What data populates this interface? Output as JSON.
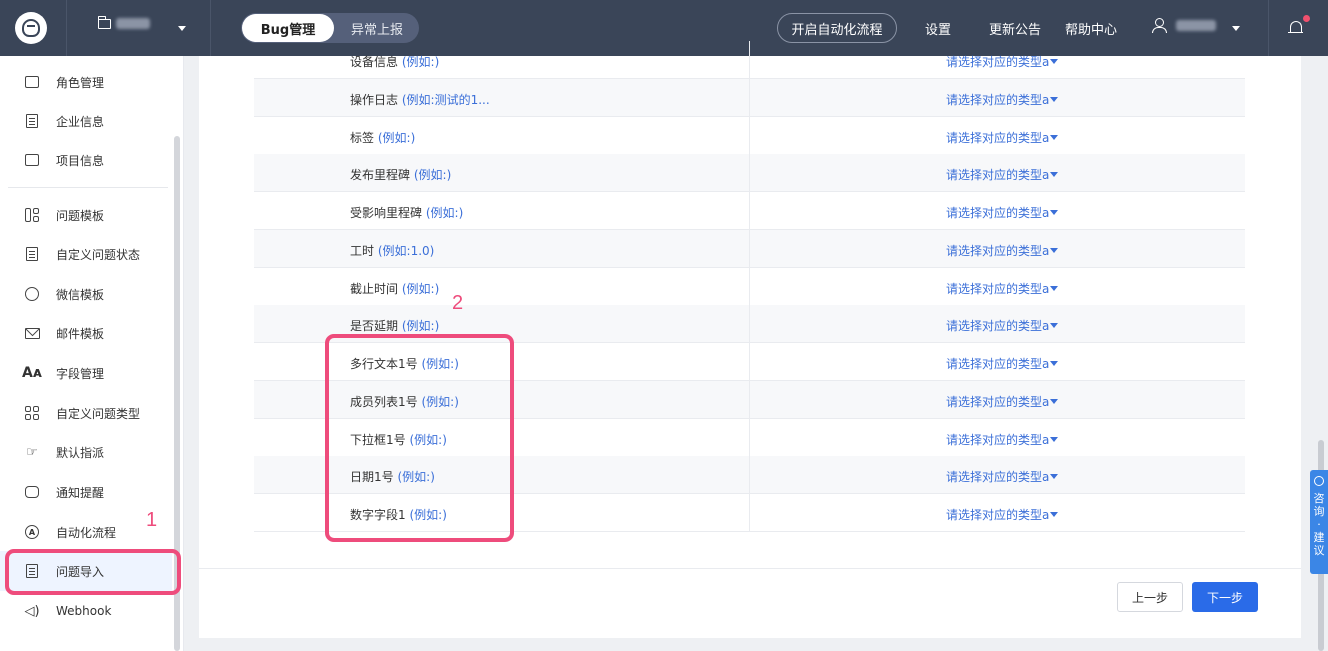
{
  "topbar": {
    "mode_active": "Bug管理",
    "mode_inactive": "异常上报",
    "auto_flow_button": "开启自动化流程",
    "nav": [
      "设置",
      "更新公告",
      "帮助中心"
    ]
  },
  "sidebar": {
    "items": [
      {
        "label": "角色管理",
        "icon": "id-card-icon"
      },
      {
        "label": "企业信息",
        "icon": "building-icon"
      },
      {
        "label": "项目信息",
        "icon": "folder-icon"
      },
      {
        "label": "问题模板",
        "icon": "layout-icon"
      },
      {
        "label": "自定义问题状态",
        "icon": "clipboard-check-icon"
      },
      {
        "label": "微信模板",
        "icon": "wechat-icon"
      },
      {
        "label": "邮件模板",
        "icon": "mail-icon"
      },
      {
        "label": "字段管理",
        "icon": "font-icon"
      },
      {
        "label": "自定义问题类型",
        "icon": "grid-icon"
      },
      {
        "label": "默认指派",
        "icon": "hand-icon"
      },
      {
        "label": "通知提醒",
        "icon": "notification-icon"
      },
      {
        "label": "自动化流程",
        "icon": "auto-icon"
      },
      {
        "label": "问题导入",
        "icon": "import-icon"
      },
      {
        "label": "Webhook",
        "icon": "speaker-icon"
      }
    ],
    "active_index": 12
  },
  "mapping": {
    "rows": [
      {
        "name": "设备信息",
        "example": "(例如:)"
      },
      {
        "name": "操作日志",
        "example": "(例如:测试的1..."
      },
      {
        "name": "标签",
        "example": "(例如:)"
      },
      {
        "name": "发布里程碑",
        "example": "(例如:)"
      },
      {
        "name": "受影响里程碑",
        "example": "(例如:)"
      },
      {
        "name": "工时",
        "example": "(例如:1.0)"
      },
      {
        "name": "截止时间",
        "example": "(例如:)"
      },
      {
        "name": "是否延期",
        "example": "(例如:)"
      },
      {
        "name": "多行文本1号",
        "example": "(例如:)"
      },
      {
        "name": "成员列表1号",
        "example": "(例如:)"
      },
      {
        "name": "下拉框1号",
        "example": "(例如:)"
      },
      {
        "name": "日期1号",
        "example": "(例如:)"
      },
      {
        "name": "数字字段1",
        "example": "(例如:)"
      }
    ],
    "select_placeholder": "请选择对应的类型a"
  },
  "footer": {
    "prev_label": "上一步",
    "next_label": "下一步"
  },
  "annotations": {
    "label_1": "1",
    "label_2": "2",
    "color": "#ee4c7c"
  },
  "feedback": {
    "chars": [
      "咨",
      "询",
      "·",
      "建",
      "议"
    ]
  },
  "colors": {
    "topbar": "#3a4558",
    "link": "#3b6fd8",
    "primary": "#2a6be8"
  }
}
